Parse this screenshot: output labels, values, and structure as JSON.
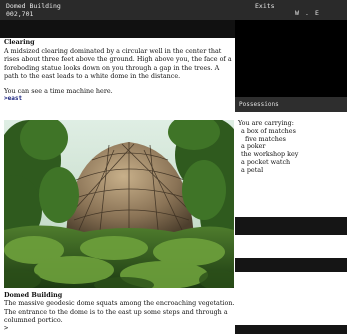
{
  "status": {
    "location": "Domed Building",
    "score": "002,701",
    "exits_label": "Exits",
    "exits": [
      "W",
      ".",
      "E"
    ]
  },
  "possessions_header": "Possessions",
  "room1": {
    "title": "Clearing",
    "description": "A midsized clearing dominated by a circular well in the center that rises about three feet above the ground. High above you, the face of a foreboding statue looks down on you through a gap in the trees. A path to the east leads to a white dome in the distance.",
    "extra": "You can see a time machine here."
  },
  "command": ">east",
  "inventory": {
    "title": "You are carrying:",
    "items": [
      {
        "label": "a box of matches",
        "sub": false
      },
      {
        "label": "five matches",
        "sub": true
      },
      {
        "label": "a poker",
        "sub": false
      },
      {
        "label": "the workshop key",
        "sub": false
      },
      {
        "label": "a pocket watch",
        "sub": false
      },
      {
        "label": "a petal",
        "sub": false
      }
    ]
  },
  "room2": {
    "title": "Domed Building",
    "description": "The massive geodesic dome squats among the encroaching vegetation. The entrance to the dome is to the east up some steps and through a columned portico."
  },
  "prompt": ">"
}
